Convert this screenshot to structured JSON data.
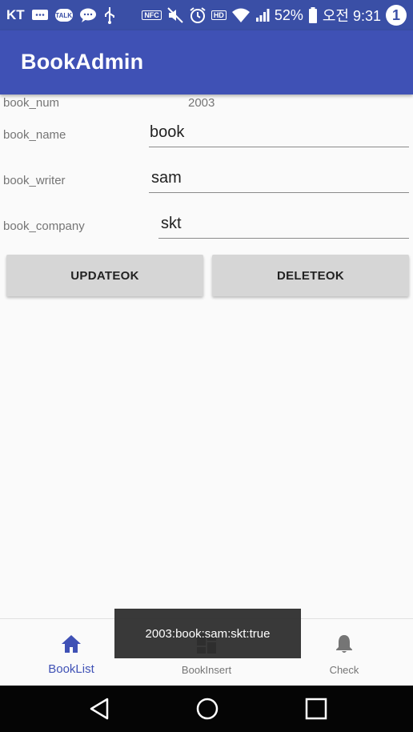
{
  "status_bar": {
    "carrier": "KT",
    "talk_badge": "TALK",
    "nfc_badge": "NFC",
    "hd_badge": "HD",
    "battery": "52%",
    "time": "오전 9:31",
    "notification_count": "1"
  },
  "app_bar": {
    "title": "BookAdmin"
  },
  "form": {
    "book_num_label": "book_num",
    "book_num_value": "2003",
    "book_name_label": "book_name",
    "book_name_value": "book",
    "book_writer_label": "book_writer",
    "book_writer_value": "sam",
    "book_company_label": "book_company",
    "book_company_value": "skt"
  },
  "buttons": {
    "update": "UPDATEOK",
    "delete": "DELETEOK"
  },
  "bottom_nav": {
    "items": [
      {
        "label": "BookList",
        "icon": "home-icon",
        "active": true
      },
      {
        "label": "BookInsert",
        "icon": "dashboard-icon",
        "active": false
      },
      {
        "label": "Check",
        "icon": "bell-icon",
        "active": false
      }
    ]
  },
  "toast": {
    "message": "2003:book:sam:skt:true"
  },
  "colors": {
    "primary": "#3f51b5",
    "status_bar": "#3a4fa6",
    "button_bg": "#d6d6d6"
  }
}
